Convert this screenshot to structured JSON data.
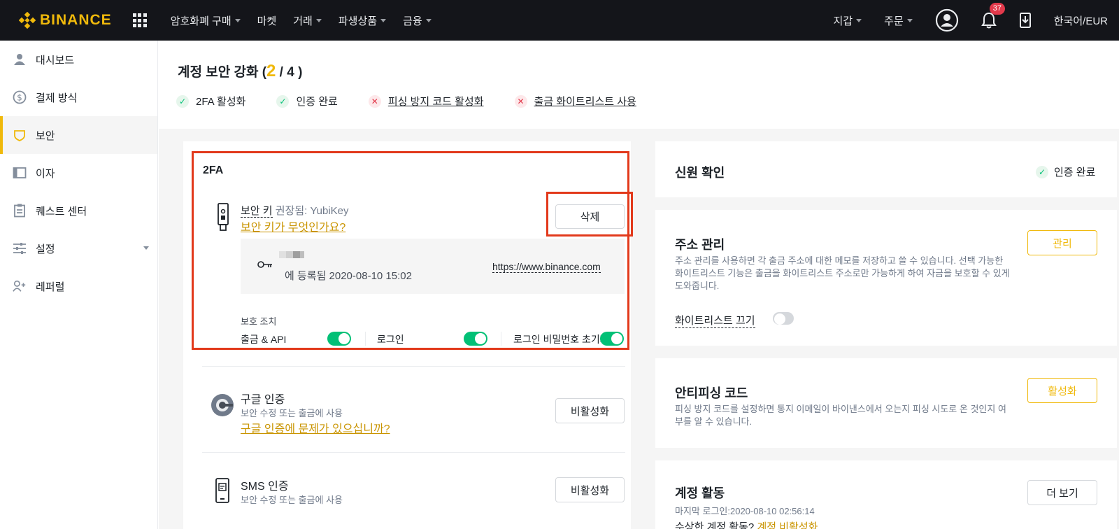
{
  "nav": {
    "logo": "BINANCE",
    "items": [
      {
        "label": "암호화폐 구매",
        "dropdown": true
      },
      {
        "label": "마켓",
        "dropdown": false
      },
      {
        "label": "거래",
        "dropdown": true
      },
      {
        "label": "파생상품",
        "dropdown": true
      },
      {
        "label": "금융",
        "dropdown": true
      }
    ],
    "wallet": "지갑",
    "orders": "주문",
    "notification_count": "37",
    "locale": "한국어/EUR"
  },
  "sidebar": {
    "items": [
      {
        "label": "대시보드",
        "icon": "user-icon"
      },
      {
        "label": "결제 방식",
        "icon": "dollar-icon"
      },
      {
        "label": "보안",
        "icon": "shield-icon",
        "active": true
      },
      {
        "label": "이자",
        "icon": "interest-icon"
      },
      {
        "label": "퀘스트 센터",
        "icon": "clipboard-icon"
      },
      {
        "label": "설정",
        "icon": "sliders-icon",
        "dropdown": true
      },
      {
        "label": "레퍼럴",
        "icon": "add-user-icon"
      }
    ]
  },
  "security": {
    "title_prefix": "계정 보안 강화 (",
    "current": "2",
    "total_suffix": " / 4 )",
    "checks": [
      {
        "label": "2FA 활성화",
        "done": true
      },
      {
        "label": "인증 완료",
        "done": true
      },
      {
        "label": "피싱 방지 코드 활성화",
        "done": false
      },
      {
        "label": "출금 화이트리스트 사용",
        "done": false
      }
    ]
  },
  "twofa": {
    "title": "2FA",
    "security_key": {
      "label": "보안 키",
      "recommended": "권장됨: YubiKey",
      "help_link": "보안 키가 무엇인가요?",
      "delete_button": "삭제",
      "registered": "에 등록됨 2020-08-10 15:02",
      "url": "https://www.binance.com"
    },
    "protection_label": "보호 조치",
    "protections": [
      {
        "label": "출금 & API",
        "enabled": true
      },
      {
        "label": "로그인",
        "enabled": true
      },
      {
        "label": "로그인 비밀번호 초기화",
        "enabled": true
      }
    ],
    "google": {
      "title": "구글 인증",
      "subtitle": "보안 수정 또는 출금에 사용",
      "help_link": "구글 인증에 문제가 있으십니까?",
      "button": "비활성화"
    },
    "sms": {
      "title": "SMS 인증",
      "subtitle": "보안 수정 또는 출금에 사용",
      "button": "비활성화"
    }
  },
  "identity": {
    "title": "신원 확인",
    "status": "인증 완료"
  },
  "address": {
    "title": "주소 관리",
    "desc": "주소 관리를 사용하면 각 출금 주소에 대한 메모를 저장하고 쓸 수 있습니다. 선택 가능한 화이트리스트 기능은 출금을 화이트리스트 주소로만 가능하게 하여 자금을 보호할 수 있게 도와줍니다.",
    "button": "관리",
    "whitelist_label": "화이트리스트 끄기",
    "whitelist_enabled": false
  },
  "antiphishing": {
    "title": "안티피싱 코드",
    "desc": "피싱 방지 코드를 설정하면 통지 이메일이 바이낸스에서 오는지 피싱 시도로 온 것인지 여부를 알 수 있습니다.",
    "button": "활성화"
  },
  "activity": {
    "title": "계정 활동",
    "last_login": "마지막 로그인:2020-08-10 02:56:14",
    "button": "더 보기",
    "suspicious": "수상한 계정 활동?",
    "disable_link": "계정 비활성화"
  },
  "colors": {
    "brand": "#F0B90B",
    "success": "#02C076",
    "danger": "#E2394B",
    "highlight": "#E2391B"
  }
}
